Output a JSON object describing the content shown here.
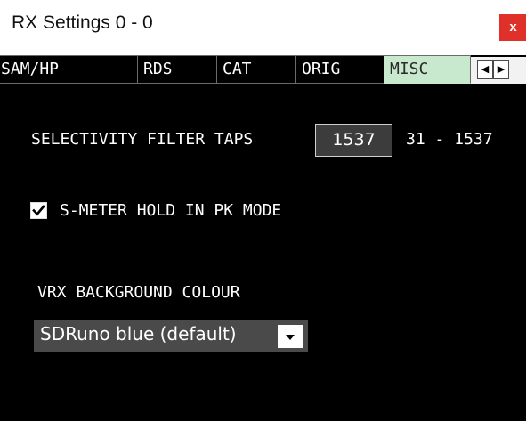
{
  "window": {
    "title": "RX Settings 0 - 0",
    "close_label": "x"
  },
  "tabs": [
    {
      "label": "SAM/HP",
      "active": false
    },
    {
      "label": "RDS",
      "active": false
    },
    {
      "label": "CAT",
      "active": false
    },
    {
      "label": "ORIG",
      "active": false
    },
    {
      "label": "MISC",
      "active": true
    }
  ],
  "tab_scroll": {
    "left_icon": "arrow-left-icon",
    "right_icon": "arrow-right-icon",
    "left_glyph": "◀",
    "right_glyph": "▶"
  },
  "misc": {
    "selectivity": {
      "label": "SELECTIVITY FILTER TAPS",
      "value": "1537",
      "range": "31 - 1537"
    },
    "smeter_hold": {
      "label": "S-METER HOLD IN PK MODE",
      "checked": true
    },
    "vrx_background": {
      "label": "VRX BACKGROUND COLOUR",
      "selected": "SDRuno blue (default)"
    }
  },
  "colors": {
    "background": "#000000",
    "active_tab": "#c9e9cf",
    "close_button": "#e0302a",
    "input_bg": "#3c3c3c",
    "dropdown_bg": "#4a4a4a"
  }
}
